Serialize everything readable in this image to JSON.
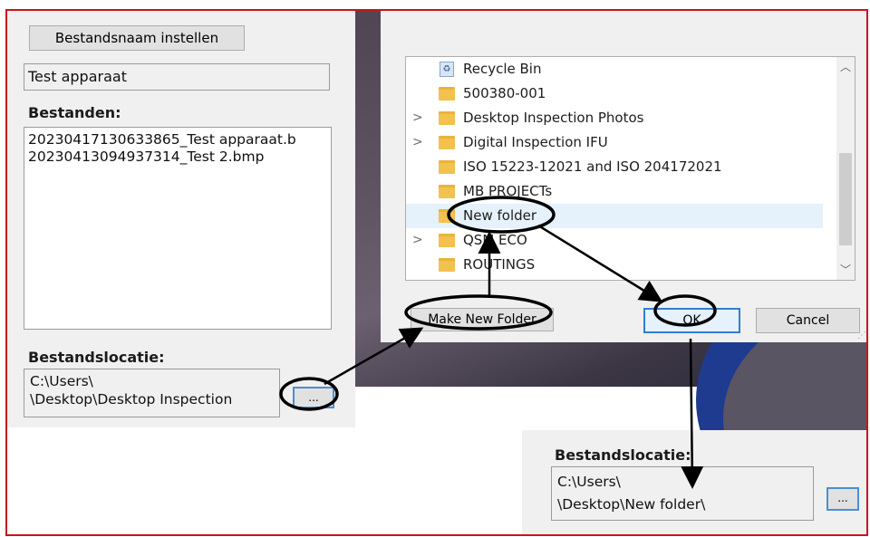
{
  "left_panel": {
    "set_name_button": "Bestandsnaam instellen",
    "name_value": "Test apparaat",
    "files_label": "Bestanden:",
    "files": [
      "20230417130633865_Test apparaat.b",
      "20230413094937314_Test 2.bmp"
    ],
    "location_label": "Bestandslocatie:",
    "location_lines": [
      "C:\\Users\\",
      "\\Desktop\\Desktop Inspection"
    ],
    "browse_button": "..."
  },
  "dialog": {
    "folders": [
      {
        "label": "Recycle Bin",
        "icon": "recycle-bin-icon",
        "expandable": false
      },
      {
        "label": "500380-001",
        "icon": "folder-icon",
        "expandable": false
      },
      {
        "label": "Desktop Inspection Photos",
        "icon": "folder-icon",
        "expandable": true
      },
      {
        "label": "Digital Inspection IFU",
        "icon": "folder-icon",
        "expandable": true
      },
      {
        "label": "ISO 15223-12021 and ISO 204172021",
        "icon": "folder-icon",
        "expandable": false
      },
      {
        "label": "MB PROJECTs",
        "icon": "folder-icon",
        "expandable": false
      },
      {
        "label": "New folder",
        "icon": "folder-icon",
        "expandable": false,
        "selected": true
      },
      {
        "label": "QSM ECO",
        "icon": "folder-icon",
        "expandable": true
      },
      {
        "label": "ROUTINGS",
        "icon": "folder-icon",
        "expandable": false
      }
    ],
    "make_new_folder_button": "Make New Folder",
    "ok_button": "OK",
    "cancel_button": "Cancel"
  },
  "result_panel": {
    "location_label": "Bestandslocatie:",
    "location_lines": [
      "C:\\Users\\",
      "\\Desktop\\New folder\\"
    ],
    "browse_button": "..."
  },
  "colors": {
    "frame_border": "#c9141b",
    "highlight": "#2f7fd1",
    "annotation": "#000000"
  }
}
